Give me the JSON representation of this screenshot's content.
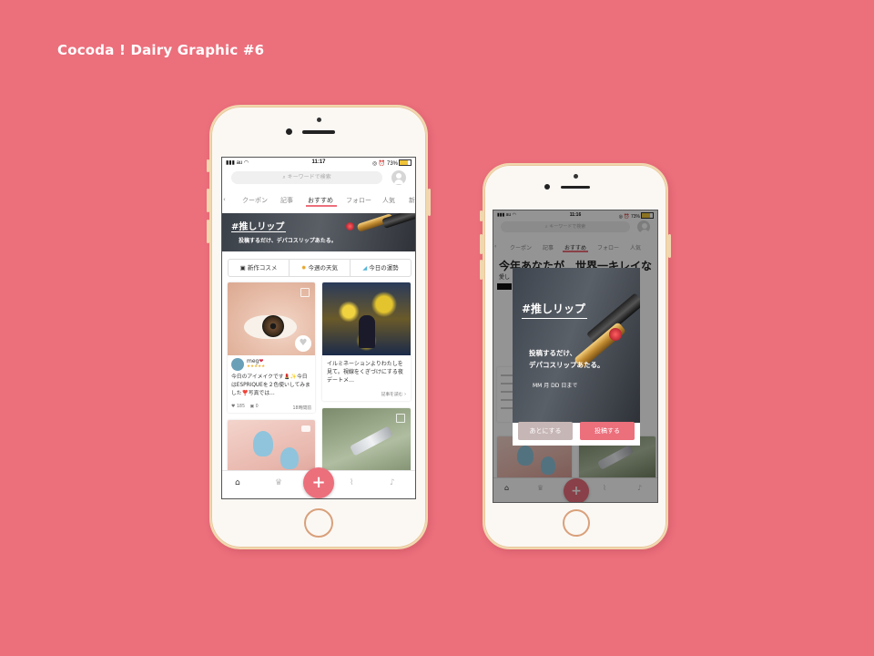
{
  "page_title": "Cocoda ! Dairy Graphic #6",
  "phone_left": {
    "status": {
      "carrier": "au",
      "time": "11:17",
      "battery": "73%",
      "battery_fill": 0.73
    },
    "search_placeholder": "キーワードで検索",
    "tabs": [
      "クーポン",
      "記事",
      "おすすめ",
      "フォロー",
      "人気"
    ],
    "active_tab": "おすすめ",
    "banner": {
      "title": "#推しリップ",
      "subtitle": "投稿するだけ、デパコスリップあたる。"
    },
    "chips": [
      {
        "icon": "calendar-icon",
        "label": "新作コスメ"
      },
      {
        "icon": "sun-icon",
        "label": "今週の天気"
      },
      {
        "icon": "hairdryer-icon",
        "label": "今日の運勢"
      }
    ],
    "cards": [
      {
        "user": "meg",
        "text": "今日のアイメイクです💄✨今日はESPRIQUEを２色使いしてみました❣️写真では…",
        "likes": "185",
        "comments": "0",
        "time": "18時間前"
      },
      {
        "text": "イルミネーションよりわたしを見て。視線をくぎづけにする夜デートメ…",
        "link": "記事を読む ›"
      }
    ],
    "fab": "+"
  },
  "phone_right": {
    "status": {
      "carrier": "au",
      "time": "11:16",
      "battery": "73%",
      "battery_fill": 0.73
    },
    "search_placeholder": "キーワードで検索",
    "tabs": [
      "クーポン",
      "記事",
      "おすすめ",
      "フォロー",
      "人気"
    ],
    "active_tab": "おすすめ",
    "bg_headline": "今年あなたが　世界一キレイな",
    "bg_sub": "愛し",
    "modal": {
      "title": "#推しリップ",
      "line1": "投稿するだけ、",
      "line2": "デパコスリップあたる。",
      "deadline": "MM 月 DD 日まで",
      "later_label": "あとにする",
      "post_label": "投稿する"
    },
    "fab": "+"
  },
  "colors": {
    "background": "#ec6f7c",
    "accent": "#ec6f7c",
    "phone_frame": "#fbf8f4",
    "gold": "#f1d7ae"
  }
}
